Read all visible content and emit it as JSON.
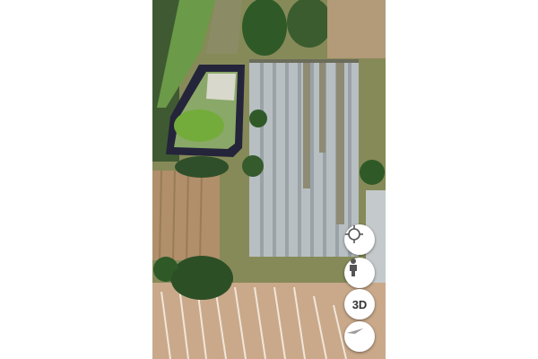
{
  "map": {
    "view": "satellite"
  },
  "controls": {
    "locate_icon": "crosshair-icon",
    "pegman_icon": "pegman-icon",
    "view_3d_label": "3D",
    "compass_icon": "compass-icon",
    "compass_north_color": "#e53935"
  }
}
